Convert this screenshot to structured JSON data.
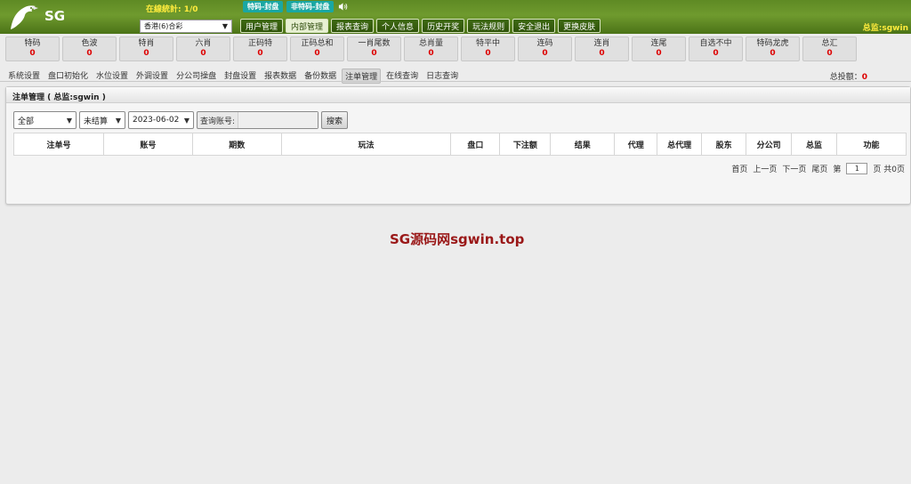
{
  "header": {
    "logo_text": "SG",
    "online_stat": "在線統計: 1/0",
    "lottery_select": "香港(6)合彩",
    "badges": [
      "特码-封盘",
      "非特码-封盘"
    ],
    "nav_tabs": [
      {
        "label": "用户管理",
        "active": false
      },
      {
        "label": "内部管理",
        "active": true
      },
      {
        "label": "报表查询",
        "active": false
      },
      {
        "label": "个人信息",
        "active": false
      },
      {
        "label": "历史开奖",
        "active": false
      },
      {
        "label": "玩法规则",
        "active": false
      },
      {
        "label": "安全退出",
        "active": false
      },
      {
        "label": "更换皮肤",
        "active": false
      }
    ],
    "admin_label": "总监:sgwin"
  },
  "stats": [
    {
      "label": "特码",
      "value": "0"
    },
    {
      "label": "色波",
      "value": "0"
    },
    {
      "label": "特肖",
      "value": "0"
    },
    {
      "label": "六肖",
      "value": "0"
    },
    {
      "label": "正码特",
      "value": "0"
    },
    {
      "label": "正码总和",
      "value": "0"
    },
    {
      "label": "一肖尾数",
      "value": "0"
    },
    {
      "label": "总肖量",
      "value": "0"
    },
    {
      "label": "特平中",
      "value": "0"
    },
    {
      "label": "连码",
      "value": "0"
    },
    {
      "label": "连肖",
      "value": "0"
    },
    {
      "label": "连尾",
      "value": "0"
    },
    {
      "label": "自选不中",
      "value": "0"
    },
    {
      "label": "特码龙虎",
      "value": "0"
    },
    {
      "label": "总汇",
      "value": "0"
    }
  ],
  "subnav": [
    {
      "label": "系统设置",
      "active": false
    },
    {
      "label": "盘口初始化",
      "active": false
    },
    {
      "label": "水位设置",
      "active": false
    },
    {
      "label": "外调设置",
      "active": false
    },
    {
      "label": "分公司操盘",
      "active": false
    },
    {
      "label": "封盘设置",
      "active": false
    },
    {
      "label": "报表数据",
      "active": false
    },
    {
      "label": "备份数据",
      "active": false
    },
    {
      "label": "注单管理",
      "active": true
    },
    {
      "label": "在线查询",
      "active": false
    },
    {
      "label": "日志查询",
      "active": false
    }
  ],
  "total_bet": {
    "label": "总投额：",
    "value": "0"
  },
  "panel": {
    "title": "注单管理 ( 总监:sgwin )",
    "filters": {
      "type_select": "全部",
      "status_select": "未结算",
      "date_select": "2023-06-02",
      "search_label": "查询账号:",
      "search_value": "",
      "search_button": "搜索"
    },
    "table": {
      "columns": [
        "注单号",
        "账号",
        "期数",
        "玩法",
        "盘口",
        "下注额",
        "结果",
        "代理",
        "总代理",
        "股东",
        "分公司",
        "总监",
        "功能"
      ],
      "rows": []
    },
    "pager": {
      "first": "首页",
      "prev": "上一页",
      "next": "下一页",
      "last": "尾页",
      "page_prefix": "第",
      "current_page": "1",
      "page_suffix": "页 共0页"
    }
  },
  "watermark": "SG源码网sgwin.top",
  "colors": {
    "header_green": "#5e8a24",
    "badge_teal": "#1aa7a3",
    "stat_value_red": "#dd0000",
    "highlight_yellow": "#ffec3d",
    "watermark_red": "#9a1818"
  }
}
